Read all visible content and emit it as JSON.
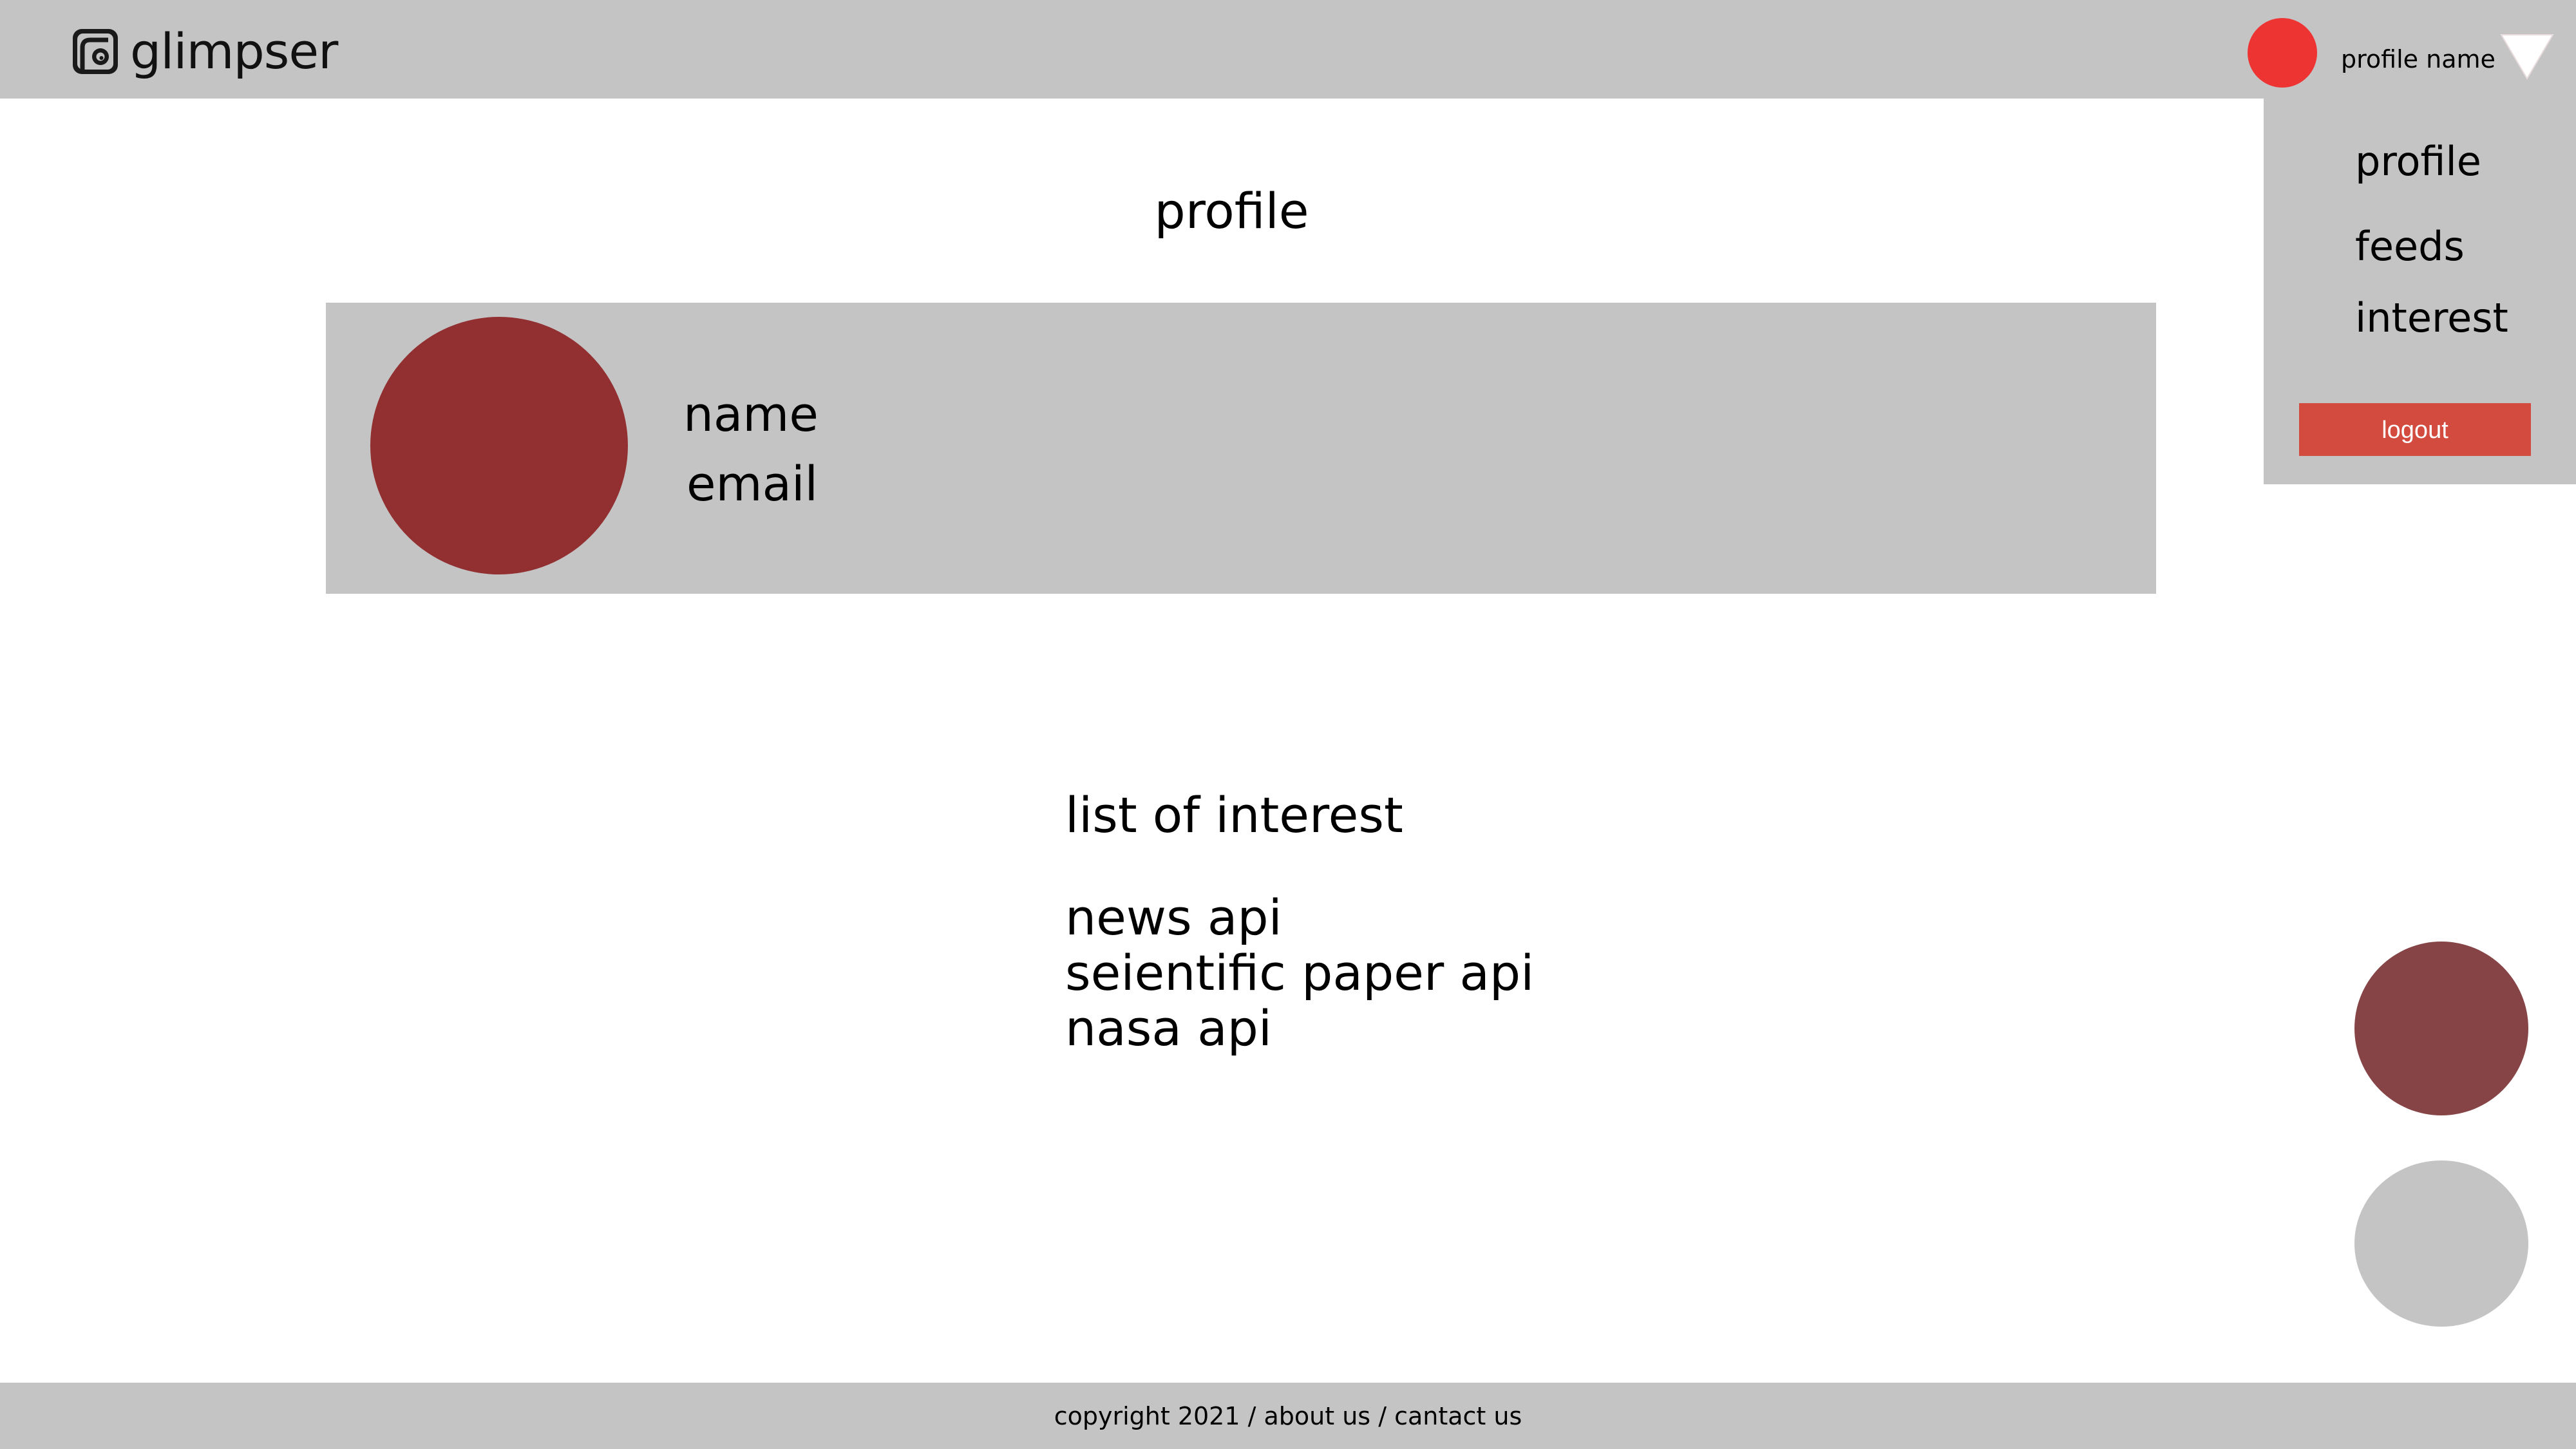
{
  "header": {
    "app_name": "glimpser",
    "profile_name": "profile name",
    "avatar_color": "#ee3433"
  },
  "dropdown": {
    "items": [
      {
        "label": "profile"
      },
      {
        "label": "feeds"
      },
      {
        "label": "interest"
      }
    ],
    "logout_label": "logout",
    "logout_color": "#d34b3e"
  },
  "main": {
    "title": "profile",
    "profile_card": {
      "name_label": "name",
      "email_label": "email",
      "avatar_color": "#922f31"
    },
    "interests": {
      "title": "list of interest",
      "items": [
        "news api",
        "seientific paper api",
        "nasa api"
      ]
    }
  },
  "floating_buttons": {
    "primary_color": "#864446",
    "secondary_color": "#c4c4c4"
  },
  "footer": {
    "copyright": "copyright 2021",
    "separator": " / ",
    "about_label": "about us",
    "contact_label": "cantact us"
  },
  "colors": {
    "panel_gray": "#c4c4c4",
    "background": "#ffffff"
  }
}
